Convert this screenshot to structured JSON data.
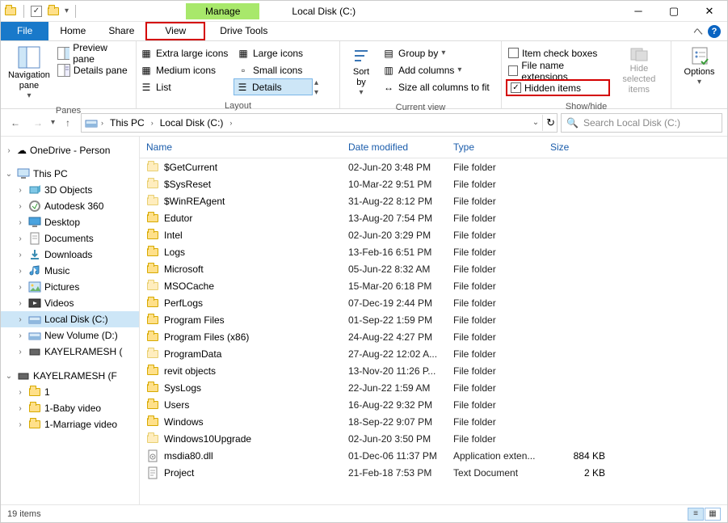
{
  "titlebar": {
    "context_tab": "Manage",
    "title": "Local Disk (C:)"
  },
  "menutabs": {
    "file": "File",
    "home": "Home",
    "share": "Share",
    "view": "View",
    "drive_tools": "Drive Tools"
  },
  "ribbon": {
    "panes": {
      "nav_pane": "Navigation\npane",
      "preview": "Preview pane",
      "details": "Details pane",
      "group": "Panes"
    },
    "layout": {
      "xl": "Extra large icons",
      "large": "Large icons",
      "medium": "Medium icons",
      "small": "Small icons",
      "list": "List",
      "details": "Details",
      "group": "Layout"
    },
    "current_view": {
      "sort": "Sort\nby",
      "group_by": "Group by",
      "add_cols": "Add columns",
      "size_all": "Size all columns to fit",
      "group": "Current view"
    },
    "show_hide": {
      "item_check": "Item check boxes",
      "file_ext": "File name extensions",
      "hidden": "Hidden items",
      "hide_sel": "Hide selected\nitems",
      "group": "Show/hide"
    },
    "options": "Options"
  },
  "breadcrumbs": [
    "This PC",
    "Local Disk (C:)"
  ],
  "search_placeholder": "Search Local Disk (C:)",
  "tree": {
    "onedrive": "OneDrive - Person",
    "this_pc": "This PC",
    "items": [
      "3D Objects",
      "Autodesk 360",
      "Desktop",
      "Documents",
      "Downloads",
      "Music",
      "Pictures",
      "Videos",
      "Local Disk (C:)",
      "New Volume (D:)",
      "KAYELRAMESH ("
    ],
    "drive2": "KAYELRAMESH (F",
    "sub": [
      "1",
      "1-Baby video",
      "1-Marriage video"
    ]
  },
  "columns": {
    "name": "Name",
    "date": "Date modified",
    "type": "Type",
    "size": "Size"
  },
  "files": [
    {
      "name": "$GetCurrent",
      "date": "02-Jun-20 3:48 PM",
      "type": "File folder",
      "size": "",
      "icon": "folder-pale"
    },
    {
      "name": "$SysReset",
      "date": "10-Mar-22 9:51 PM",
      "type": "File folder",
      "size": "",
      "icon": "folder-pale"
    },
    {
      "name": "$WinREAgent",
      "date": "31-Aug-22 8:12 PM",
      "type": "File folder",
      "size": "",
      "icon": "folder-pale"
    },
    {
      "name": "Edutor",
      "date": "13-Aug-20 7:54 PM",
      "type": "File folder",
      "size": "",
      "icon": "folder"
    },
    {
      "name": "Intel",
      "date": "02-Jun-20 3:29 PM",
      "type": "File folder",
      "size": "",
      "icon": "folder"
    },
    {
      "name": "Logs",
      "date": "13-Feb-16 6:51 PM",
      "type": "File folder",
      "size": "",
      "icon": "folder"
    },
    {
      "name": "Microsoft",
      "date": "05-Jun-22 8:32 AM",
      "type": "File folder",
      "size": "",
      "icon": "folder"
    },
    {
      "name": "MSOCache",
      "date": "15-Mar-20 6:18 PM",
      "type": "File folder",
      "size": "",
      "icon": "folder-pale"
    },
    {
      "name": "PerfLogs",
      "date": "07-Dec-19 2:44 PM",
      "type": "File folder",
      "size": "",
      "icon": "folder"
    },
    {
      "name": "Program Files",
      "date": "01-Sep-22 1:59 PM",
      "type": "File folder",
      "size": "",
      "icon": "folder"
    },
    {
      "name": "Program Files (x86)",
      "date": "24-Aug-22 4:27 PM",
      "type": "File folder",
      "size": "",
      "icon": "folder"
    },
    {
      "name": "ProgramData",
      "date": "27-Aug-22 12:02 A...",
      "type": "File folder",
      "size": "",
      "icon": "folder-pale"
    },
    {
      "name": "revit objects",
      "date": "13-Nov-20 11:26 P...",
      "type": "File folder",
      "size": "",
      "icon": "folder"
    },
    {
      "name": "SysLogs",
      "date": "22-Jun-22 1:59 AM",
      "type": "File folder",
      "size": "",
      "icon": "folder"
    },
    {
      "name": "Users",
      "date": "16-Aug-22 9:32 PM",
      "type": "File folder",
      "size": "",
      "icon": "folder"
    },
    {
      "name": "Windows",
      "date": "18-Sep-22 9:07 PM",
      "type": "File folder",
      "size": "",
      "icon": "folder"
    },
    {
      "name": "Windows10Upgrade",
      "date": "02-Jun-20 3:50 PM",
      "type": "File folder",
      "size": "",
      "icon": "folder-pale"
    },
    {
      "name": "msdia80.dll",
      "date": "01-Dec-06 11:37 PM",
      "type": "Application exten...",
      "size": "884 KB",
      "icon": "dll"
    },
    {
      "name": "Project",
      "date": "21-Feb-18 7:53 PM",
      "type": "Text Document",
      "size": "2 KB",
      "icon": "txt"
    }
  ],
  "status": "19 items"
}
